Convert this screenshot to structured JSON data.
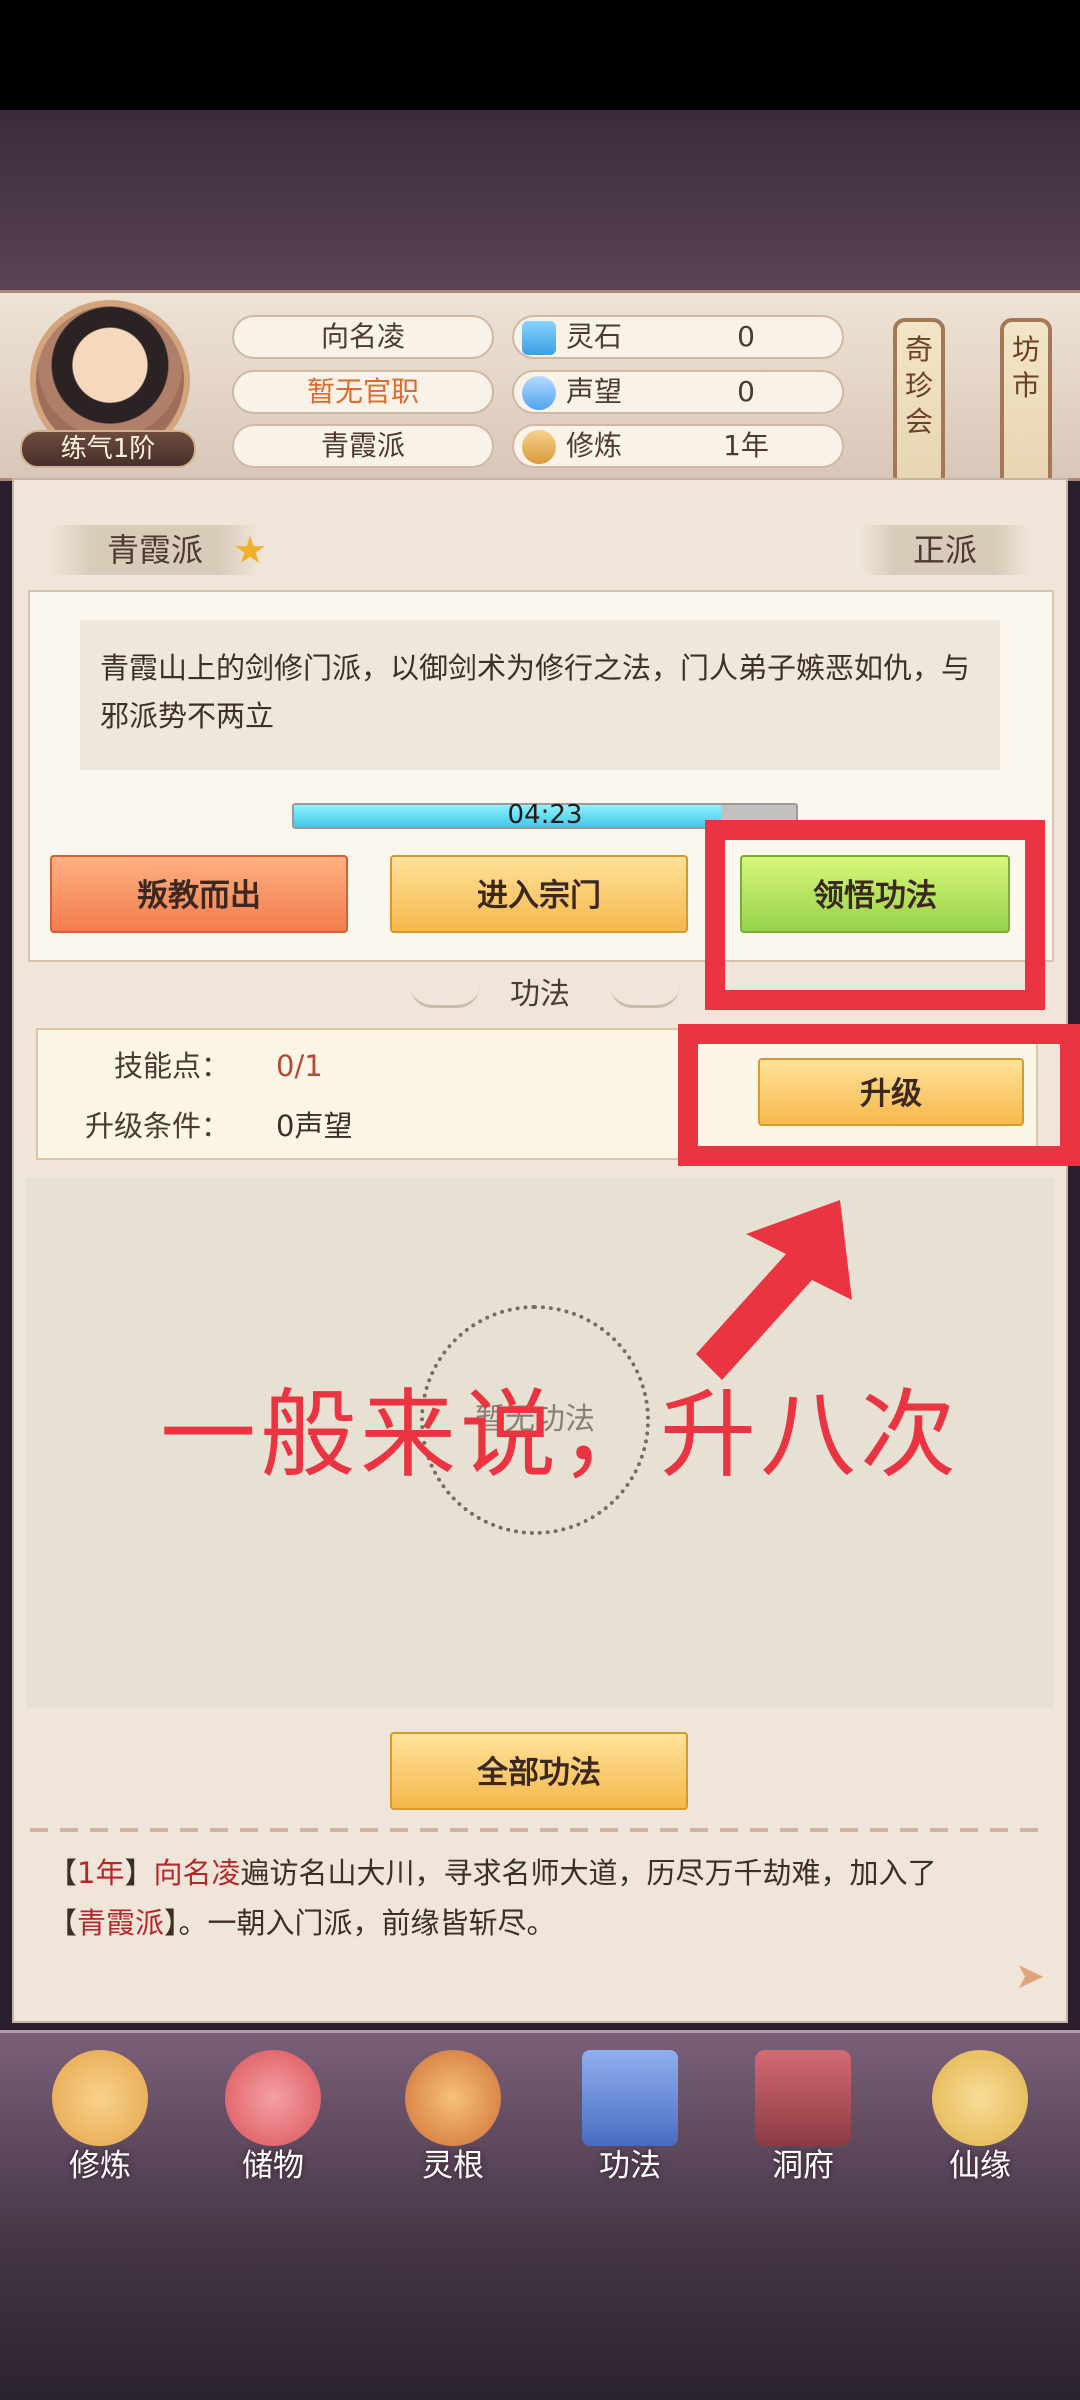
{
  "header": {
    "player_name": "向名凌",
    "official_rank": "暂无官职",
    "sect": "青霞派",
    "cultivation_tag": "练气1阶",
    "stats": [
      {
        "label": "灵石",
        "value": "0",
        "icon": "spirit-stone-icon",
        "color": "#3a9fe0"
      },
      {
        "label": "声望",
        "value": "0",
        "icon": "reputation-icon",
        "color": "#4fa3f0"
      },
      {
        "label": "修炼",
        "value": "1年",
        "icon": "meditation-icon",
        "color": "#d99a3c"
      }
    ],
    "side_buttons": [
      {
        "label": "奇珍会"
      },
      {
        "label": "坊市"
      }
    ]
  },
  "faction": {
    "name": "青霞派",
    "alignment": "正派",
    "description": "青霞山上的剑修门派，以御剑术为修行之法，门人弟子嫉恶如仇，与邪派势不两立",
    "timer": "04:23",
    "timer_progress": 0.85,
    "buttons": {
      "leave": "叛教而出",
      "enter": "进入宗门",
      "comprehend": "领悟功法"
    }
  },
  "techniques": {
    "section_title": "功法",
    "skill_points_label": "技能点：",
    "skill_points_value": "0/1",
    "upgrade_condition_label": "升级条件：",
    "upgrade_condition_value": "0声望",
    "upgrade_button": "升级",
    "empty_label": "暂无功法",
    "all_button": "全部功法"
  },
  "log": {
    "year": "1年",
    "name": "向名凌",
    "text1": "遍访名山大川，寻求名师大道，历尽万千劫难，加入了",
    "sect": "青霞派",
    "text2": "。一朝入门派，前缘皆斩尽。"
  },
  "bottom_nav": [
    {
      "label": "修炼",
      "icon": "cultivate-icon",
      "color": "#e6a449"
    },
    {
      "label": "储物",
      "icon": "storage-bag-icon",
      "color": "#d9535a"
    },
    {
      "label": "灵根",
      "icon": "spirit-root-icon",
      "color": "#cf6f38"
    },
    {
      "label": "功法",
      "icon": "technique-book-icon",
      "color": "#4a6cc0"
    },
    {
      "label": "洞府",
      "icon": "cave-icon",
      "color": "#8b3b43"
    },
    {
      "label": "仙缘",
      "icon": "fate-gourd-icon",
      "color": "#e2b24a"
    }
  ],
  "annotation": {
    "text": "一般来说，升八次",
    "color": "#ea3441"
  }
}
